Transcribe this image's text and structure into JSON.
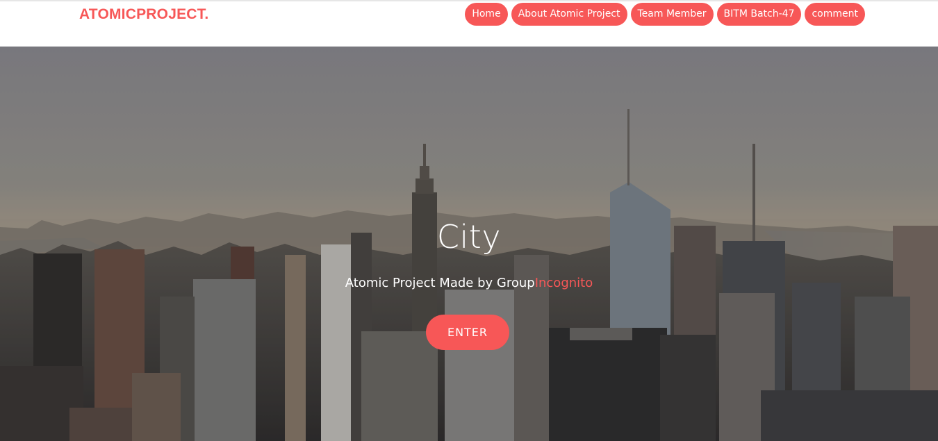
{
  "brand": {
    "name": "ATOMICPROJECT."
  },
  "nav": {
    "items": [
      {
        "label": "Home"
      },
      {
        "label": "About Atomic Project"
      },
      {
        "label": "Team Member"
      },
      {
        "label": "BITM Batch-47"
      },
      {
        "label": "comment"
      }
    ]
  },
  "hero": {
    "title": "City",
    "subtitle_main": "Atomic Project Made by Group",
    "subtitle_accent": "Incognito",
    "enter_label": "ENTER",
    "background": "city-skyline-image"
  },
  "colors": {
    "accent": "#f75757",
    "text_light": "#ffffff"
  }
}
